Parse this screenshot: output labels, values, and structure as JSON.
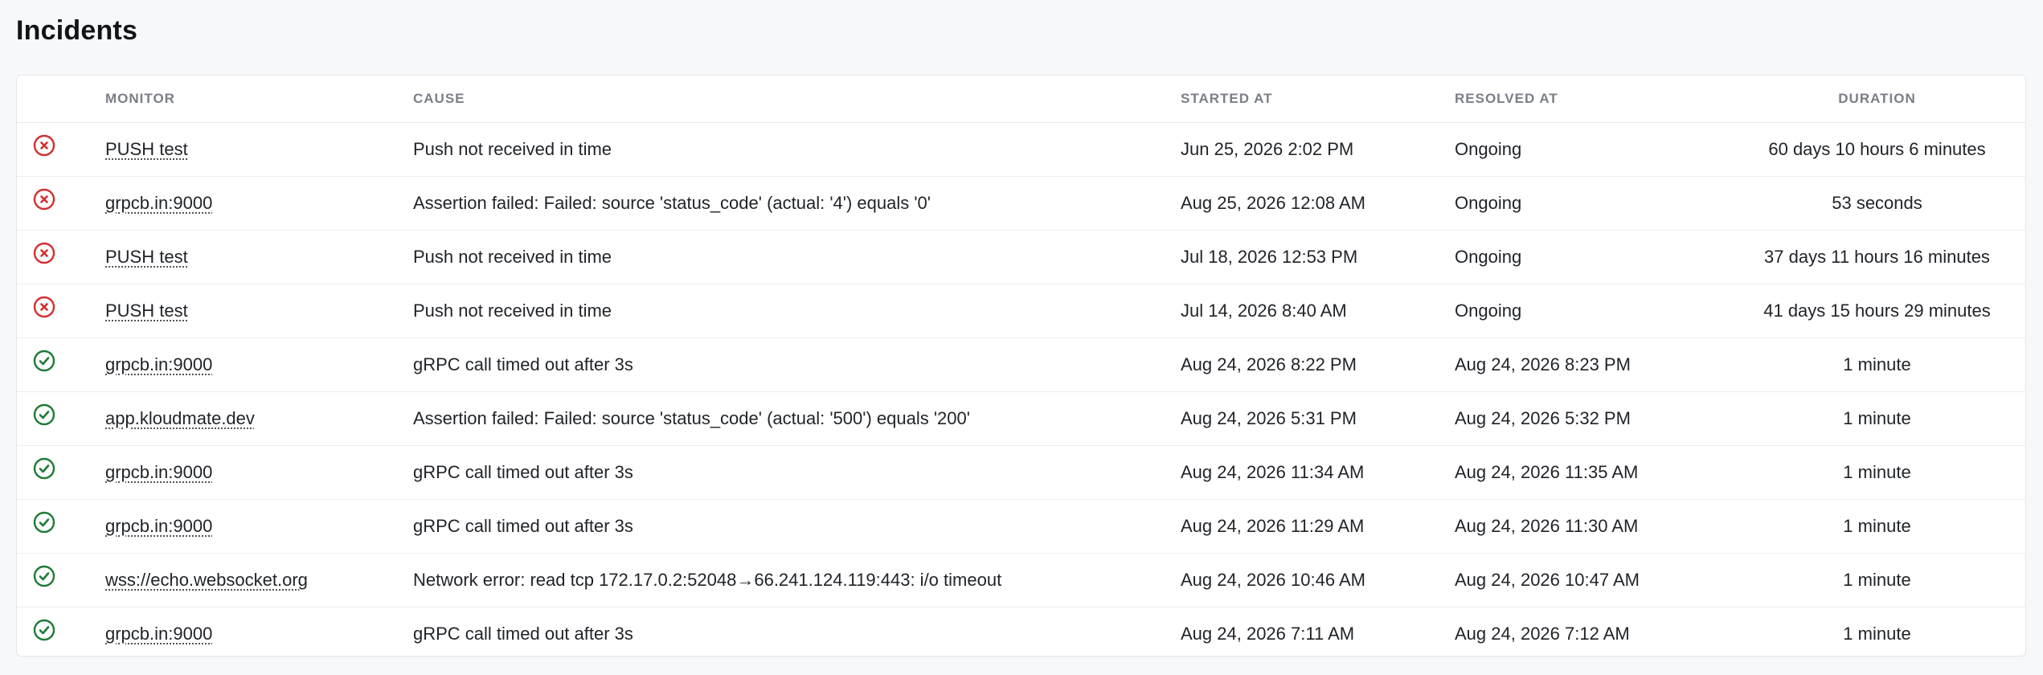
{
  "page": {
    "title": "Incidents"
  },
  "table": {
    "columns": {
      "status": "",
      "monitor": "Monitor",
      "cause": "Cause",
      "started_at": "Started At",
      "resolved_at": "Resolved At",
      "duration": "Duration"
    },
    "rows": [
      {
        "status": "failed",
        "monitor": "PUSH test",
        "cause": "Push not received in time",
        "started_at": "Jun 25, 2026 2:02 PM",
        "resolved_at": "Ongoing",
        "duration": "60 days 10 hours 6 minutes"
      },
      {
        "status": "failed",
        "monitor": "grpcb.in:9000",
        "cause": "Assertion failed: Failed: source 'status_code' (actual: '4') equals '0'",
        "started_at": "Aug 25, 2026 12:08 AM",
        "resolved_at": "Ongoing",
        "duration": "53 seconds"
      },
      {
        "status": "failed",
        "monitor": "PUSH test",
        "cause": "Push not received in time",
        "started_at": "Jul 18, 2026 12:53 PM",
        "resolved_at": "Ongoing",
        "duration": "37 days 11 hours 16 minutes"
      },
      {
        "status": "failed",
        "monitor": "PUSH test",
        "cause": "Push not received in time",
        "started_at": "Jul 14, 2026 8:40 AM",
        "resolved_at": "Ongoing",
        "duration": "41 days 15 hours 29 minutes"
      },
      {
        "status": "resolved",
        "monitor": "grpcb.in:9000",
        "cause": "gRPC call timed out after 3s",
        "started_at": "Aug 24, 2026 8:22 PM",
        "resolved_at": "Aug 24, 2026 8:23 PM",
        "duration": "1 minute"
      },
      {
        "status": "resolved",
        "monitor": "app.kloudmate.dev",
        "cause": "Assertion failed: Failed: source 'status_code' (actual: '500') equals '200'",
        "started_at": "Aug 24, 2026 5:31 PM",
        "resolved_at": "Aug 24, 2026 5:32 PM",
        "duration": "1 minute"
      },
      {
        "status": "resolved",
        "monitor": "grpcb.in:9000",
        "cause": "gRPC call timed out after 3s",
        "started_at": "Aug 24, 2026 11:34 AM",
        "resolved_at": "Aug 24, 2026 11:35 AM",
        "duration": "1 minute"
      },
      {
        "status": "resolved",
        "monitor": "grpcb.in:9000",
        "cause": "gRPC call timed out after 3s",
        "started_at": "Aug 24, 2026 11:29 AM",
        "resolved_at": "Aug 24, 2026 11:30 AM",
        "duration": "1 minute"
      },
      {
        "status": "resolved",
        "monitor": "wss://echo.websocket.org",
        "cause": "Network error: read tcp 172.17.0.2:52048→66.241.124.119:443: i/o timeout",
        "started_at": "Aug 24, 2026 10:46 AM",
        "resolved_at": "Aug 24, 2026 10:47 AM",
        "duration": "1 minute"
      },
      {
        "status": "resolved",
        "monitor": "grpcb.in:9000",
        "cause": "gRPC call timed out after 3s",
        "started_at": "Aug 24, 2026 7:11 AM",
        "resolved_at": "Aug 24, 2026 7:12 AM",
        "duration": "1 minute"
      }
    ]
  },
  "icons": {
    "failed": {
      "name": "x-circle-icon",
      "color": "#d32f2f"
    },
    "resolved": {
      "name": "check-circle-icon",
      "color": "#1e7b34"
    }
  }
}
